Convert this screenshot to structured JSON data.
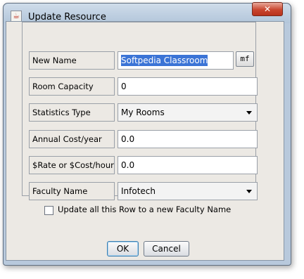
{
  "window": {
    "title": "Update Resource",
    "close_glyph": "✕",
    "icon": "java-cup-icon"
  },
  "form": {
    "new_name": {
      "label": "New Name",
      "value": "Softpedia Classroom",
      "button": "mf"
    },
    "room_capacity": {
      "label": "Room Capacity",
      "value": "0"
    },
    "statistics_type": {
      "label": "Statistics Type",
      "value": "My Rooms"
    },
    "annual_cost": {
      "label": "Annual Cost/year",
      "value": "0.0"
    },
    "rate_cost": {
      "label": "$Rate or $Cost/hour",
      "value": "0.0"
    },
    "faculty_name": {
      "label": "Faculty Name",
      "value": "Infotech"
    },
    "update_row": {
      "label": "Update all this Row to a new Faculty Name",
      "checked": false
    }
  },
  "buttons": {
    "ok": "OK",
    "cancel": "Cancel"
  }
}
